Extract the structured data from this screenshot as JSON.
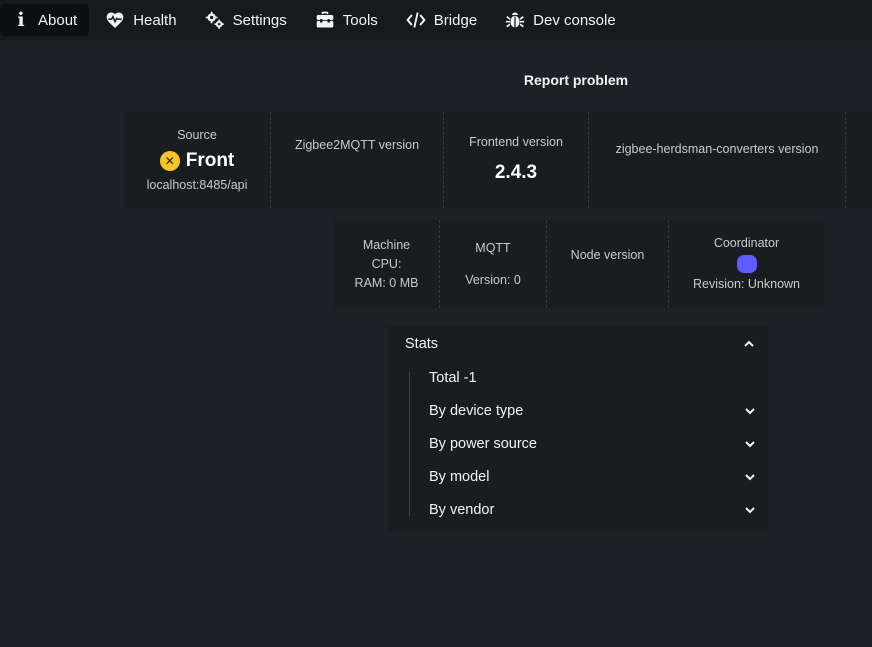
{
  "nav": {
    "tabs": [
      {
        "label": "About",
        "icon": "info-icon",
        "active": true
      },
      {
        "label": "Health",
        "icon": "heartbeat-icon"
      },
      {
        "label": "Settings",
        "icon": "gears-icon"
      },
      {
        "label": "Tools",
        "icon": "toolbox-icon"
      },
      {
        "label": "Bridge",
        "icon": "code-icon"
      },
      {
        "label": "Dev console",
        "icon": "bug-icon"
      }
    ]
  },
  "report_problem": "Report problem",
  "row1": {
    "source_label": "Source",
    "source_value": "Front",
    "source_url": "localhost:8485/api",
    "z2m_label": "Zigbee2MQTT version",
    "frontend_label": "Frontend version",
    "frontend_value": "2.4.3",
    "zhc_label": "zigbee-herdsman-converters version"
  },
  "row2": {
    "machine_label": "Machine",
    "cpu": "CPU:",
    "ram": "RAM: 0 MB",
    "mqtt_label": "MQTT",
    "mqtt_version": "Version: 0",
    "node_label": "Node version",
    "coordinator_label": "Coordinator",
    "coordinator_revision": "Revision: Unknown"
  },
  "stats": {
    "title": "Stats",
    "total": "Total -1",
    "sections": [
      "By device type",
      "By power source",
      "By model",
      "By vendor"
    ]
  },
  "colors": {
    "background": "#1d2125",
    "nav_background": "#17191c",
    "warning": "#f6c52b",
    "coordinator_dot": "#5c5cff"
  }
}
